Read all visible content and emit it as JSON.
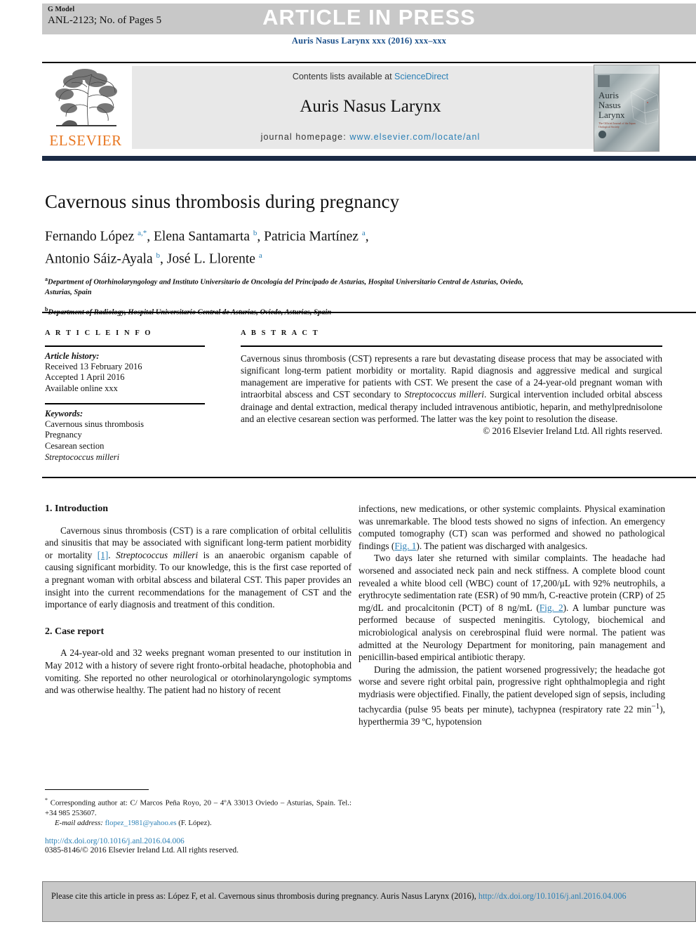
{
  "banner": {
    "g_model": "G Model",
    "article_id": "ANL-2123; No. of Pages 5",
    "status": "ARTICLE IN PRESS"
  },
  "journal_ref": "Auris Nasus Larynx xxx (2016) xxx–xxx",
  "masthead": {
    "publisher_wordmark": "ELSEVIER",
    "contents_prefix": "Contents lists available at ",
    "contents_link": "ScienceDirect",
    "journal_name": "Auris Nasus Larynx",
    "homepage_prefix": "journal homepage: ",
    "homepage_link": "www.elsevier.com/locate/anl",
    "cover": {
      "line1": "Auris",
      "line2": "Nasus",
      "line3": "Larynx",
      "subtitle": "The Official Journal of the Japan Otological Society"
    }
  },
  "article": {
    "title": "Cavernous sinus thrombosis during pregnancy",
    "authors_line1_p1": "Fernando López ",
    "authors_line1_m1": "a,*",
    "authors_line1_p2": ", Elena Santamarta ",
    "authors_line1_m2": "b",
    "authors_line1_p3": ", Patricia Martínez ",
    "authors_line1_m3": "a",
    "authors_line1_p4": ",",
    "authors_line2_p1": "Antonio Sáiz-Ayala ",
    "authors_line2_m1": "b",
    "authors_line2_p2": ", José L. Llorente ",
    "authors_line2_m2": "a",
    "affiliation_a_mark": "a",
    "affiliation_a": "Department of Otorhinolaryngology and Instituto Universitario de Oncología del Principado de Asturias, Hospital Universitario Central de Asturias, Oviedo, Asturias, Spain",
    "affiliation_b_mark": "b",
    "affiliation_b": "Department of Radiology, Hospital Universitario Central de Asturias, Oviedo, Asturias, Spain"
  },
  "article_info": {
    "heading": "A R T I C L E  I N F O",
    "history_label": "Article history:",
    "history": [
      "Received 13 February 2016",
      "Accepted 1 April 2016",
      "Available online xxx"
    ],
    "keywords_label": "Keywords:",
    "keywords": [
      "Cavernous sinus thrombosis",
      "Pregnancy",
      "Cesarean section"
    ],
    "keyword_italic": "Streptococcus milleri"
  },
  "abstract": {
    "heading": "A B S T R A C T",
    "p1": "Cavernous sinus thrombosis (CST) represents a rare but devastating disease process that may be associated with significant long-term patient morbidity or mortality. Rapid diagnosis and aggressive medical and surgical management are imperative for patients with CST. We present the case of a 24-year-old pregnant woman with intraorbital abscess and CST secondary to ",
    "p1_italic": "Streptococcus milleri",
    "p2": ". Surgical intervention included orbital abscess drainage and dental extraction, medical therapy included intravenous antibiotic, heparin, and methylprednisolone and an elective cesarean section was performed. The latter was the key point to resolution the disease.",
    "copyright": "© 2016 Elsevier Ireland Ltd. All rights reserved."
  },
  "body": {
    "section1_heading": "1. Introduction",
    "section1_p1_a": "Cavernous sinus thrombosis (CST) is a rare complication of orbital cellulitis and sinusitis that may be associated with significant long-term patient morbidity or mortality ",
    "section1_p1_ref": "[1]",
    "section1_p1_b": ". ",
    "section1_p1_italic": "Streptococcus milleri",
    "section1_p1_c": " is an anaerobic organism capable of causing significant morbidity. To our knowledge, this is the first case reported of a pregnant woman with orbital abscess and bilateral CST. This paper provides an insight into the current recommendations for the management of CST and the importance of early diagnosis and treatment of this condition.",
    "section2_heading": "2. Case report",
    "section2_p1": "A 24-year-old and 32 weeks pregnant woman presented to our institution in May 2012 with a history of severe right fronto-orbital headache, photophobia and vomiting. She reported no other neurological or otorhinolaryngologic symptoms and was otherwise healthy. The patient had no history of recent",
    "right_p1_a": "infections, new medications, or other systemic complaints. Physical examination was unremarkable. The blood tests showed no signs of infection. An emergency computed tomography (CT) scan was performed and showed no pathological findings (",
    "right_p1_ref": "Fig. 1",
    "right_p1_b": "). The patient was discharged with analgesics.",
    "right_p2_a": "Two days later she returned with similar complaints. The headache had worsened and associated neck pain and neck stiffness. A complete blood count revealed a white blood cell (WBC) count of 17,200/μL with 92% neutrophils, a erythrocyte sedimentation rate (ESR) of 90 mm/h, C-reactive protein (CRP) of 25 mg/dL and procalcitonin (PCT) of 8 ng/mL (",
    "right_p2_ref": "Fig. 2",
    "right_p2_b": "). A lumbar puncture was performed because of suspected meningitis. Cytology, biochemical and microbiological analysis on cerebrospinal fluid were normal. The patient was admitted at the Neurology Department for monitoring, pain management and penicillin-based empirical antibiotic therapy.",
    "right_p3_a": "During the admission, the patient worsened progressively; the headache got worse and severe right orbital pain, progressive right ophthalmoplegia and right mydriasis were objectified. Finally, the patient developed sign of sepsis, including tachycardia (pulse 95 beats per minute), tachypnea (respiratory rate 22 min",
    "right_p3_sup": "−1",
    "right_p3_b": "), hyperthermia 39 ºC, hypotension"
  },
  "footnotes": {
    "corresponding_mark": "*",
    "corresponding": " Corresponding author at: C/ Marcos Peña Royo, 20 – 4ºA 33013 Oviedo – Asturias, Spain. Tel.: +34 985 253607.",
    "email_label": "E-mail address:",
    "email": "flopez_1981@yahoo.es",
    "email_suffix": " (F. López).",
    "doi": "http://dx.doi.org/10.1016/j.anl.2016.04.006",
    "issn": "0385-8146/© 2016 Elsevier Ireland Ltd. All rights reserved."
  },
  "cite_box": {
    "text": "Please cite this article in press as: López F, et al. Cavernous sinus thrombosis during pregnancy. Auris Nasus Larynx (2016), ",
    "link1": "http://dx.doi.org/",
    "link2": "10.1016/j.anl.2016.04.006"
  },
  "colors": {
    "link": "#2a7fb5",
    "elsevier_orange": "#E87722",
    "banner_gray": "#c8c8c8",
    "panel_gray": "#e8e8e8",
    "rule_navy": "#1b2b45"
  }
}
